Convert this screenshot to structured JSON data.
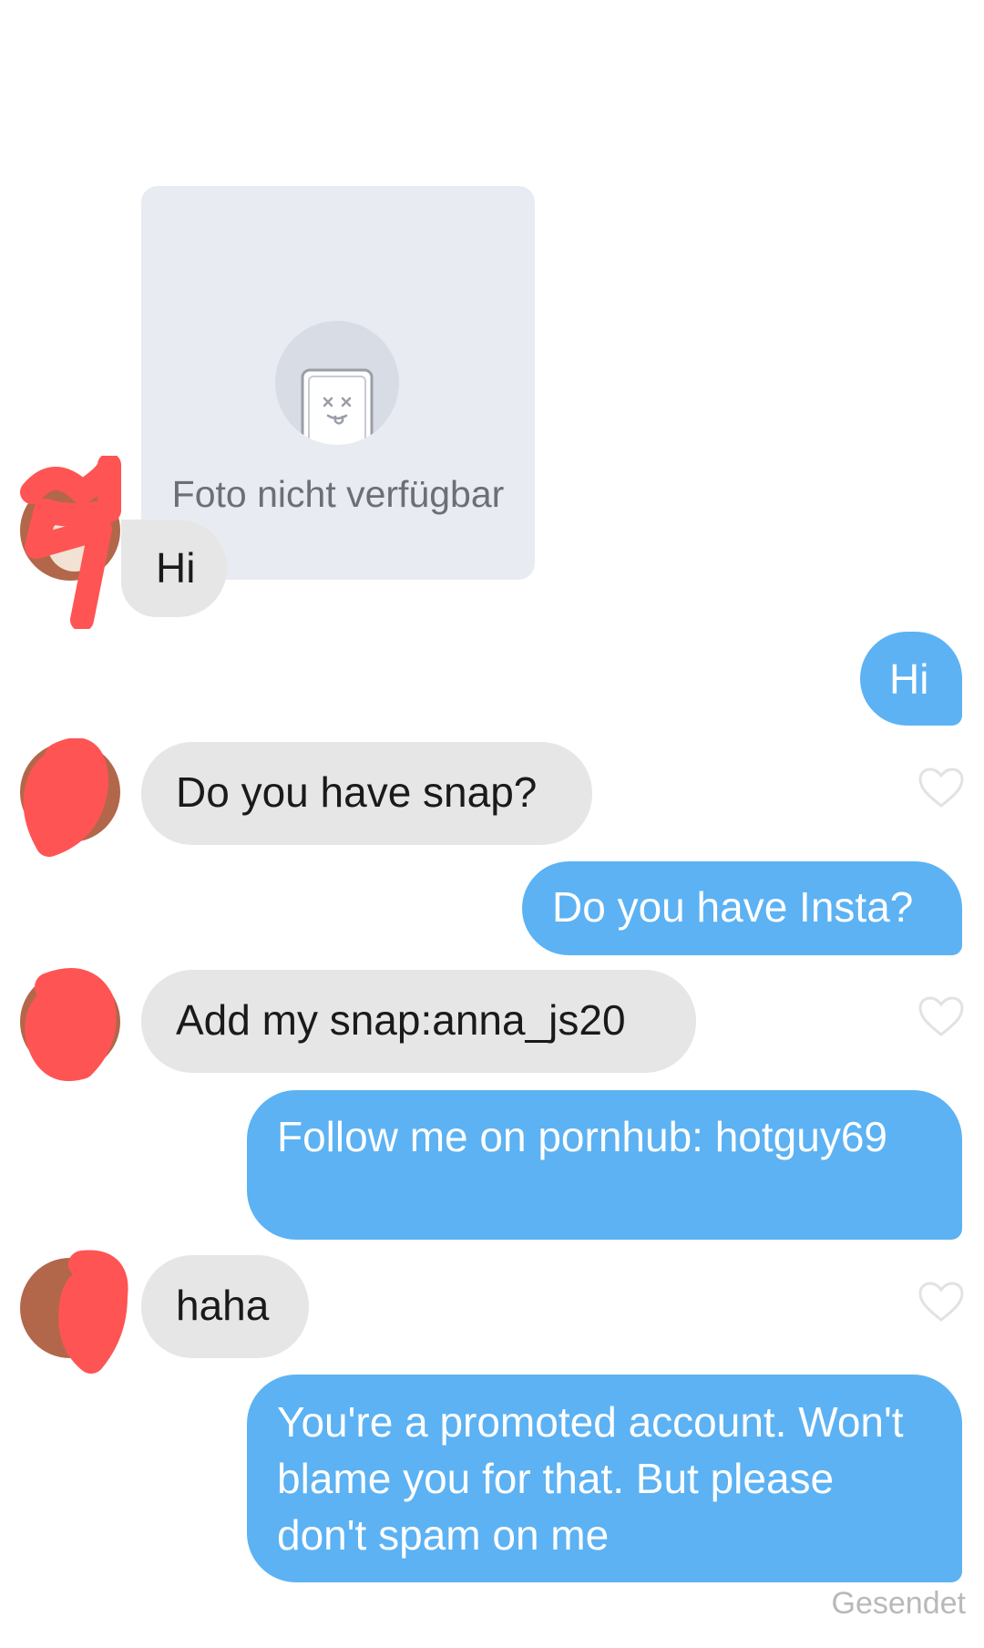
{
  "photo_card": {
    "caption": "Foto nicht verfügbar",
    "icon": "broken-image-face-icon"
  },
  "messages": [
    {
      "side": "received",
      "text": "Hi"
    },
    {
      "side": "sent",
      "text": "Hi"
    },
    {
      "side": "received",
      "text": "Do you have snap?",
      "like_icon": "heart-outline-icon"
    },
    {
      "side": "sent",
      "text": "Do you have Insta?"
    },
    {
      "side": "received",
      "text": "Add my snap:anna_js20",
      "like_icon": "heart-outline-icon"
    },
    {
      "side": "sent",
      "text": "Follow me on pornhub: hotguy69"
    },
    {
      "side": "received",
      "text": "haha",
      "like_icon": "heart-outline-icon"
    },
    {
      "side": "sent",
      "text": "You're a promoted account. Won't blame you for that. But please don't spam on me"
    }
  ],
  "status_text": "Gesendet",
  "colors": {
    "sent_bubble": "#5cb2f3",
    "received_bubble": "#e6e6e6",
    "redaction": "#ff5454"
  }
}
